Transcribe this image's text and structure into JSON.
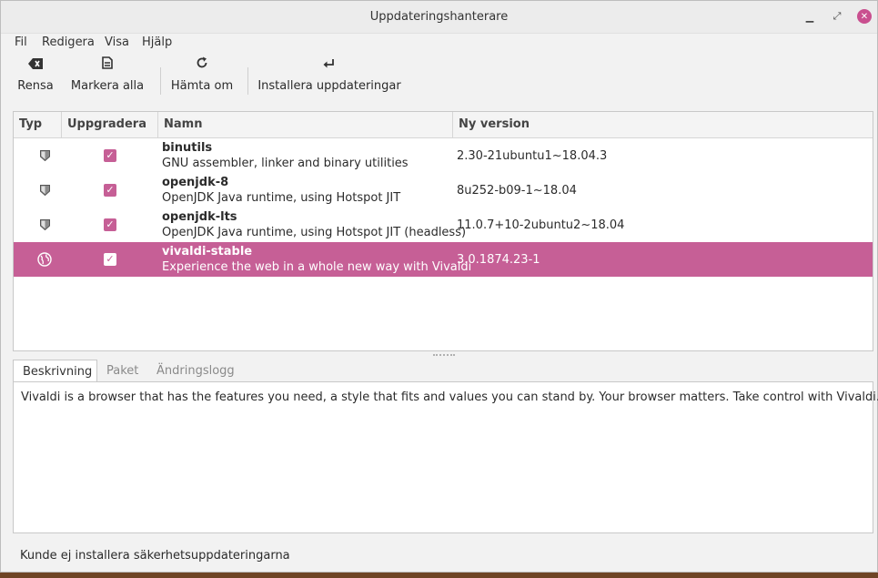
{
  "window": {
    "title": "Uppdateringshanterare"
  },
  "menu": {
    "file": "Fil",
    "edit": "Redigera",
    "view": "Visa",
    "help": "Hjälp"
  },
  "toolbar": {
    "clear": {
      "label": "Rensa",
      "icon": "backspace-icon"
    },
    "select_all": {
      "label": "Markera alla",
      "icon": "document-icon"
    },
    "refresh": {
      "label": "Hämta om",
      "icon": "refresh-icon"
    },
    "install": {
      "label": "Installera uppdateringar",
      "icon": "return-arrow-icon"
    }
  },
  "table": {
    "headers": {
      "type": "Typ",
      "upgrade": "Uppgradera",
      "name": "Namn",
      "new_version": "Ny version"
    },
    "rows": [
      {
        "icon": "shield-icon",
        "checked": true,
        "name": "binutils",
        "description": "GNU assembler, linker and binary utilities",
        "version": "2.30-21ubuntu1~18.04.3"
      },
      {
        "icon": "shield-icon",
        "checked": true,
        "name": "openjdk-8",
        "description": "OpenJDK Java runtime, using Hotspot JIT",
        "version": "8u252-b09-1~18.04"
      },
      {
        "icon": "shield-icon",
        "checked": true,
        "name": "openjdk-lts",
        "description": "OpenJDK Java runtime, using Hotspot JIT (headless)",
        "version": "11.0.7+10-2ubuntu2~18.04"
      },
      {
        "icon": "globe-icon",
        "checked": true,
        "name": "vivaldi-stable",
        "description": "Experience the web in a whole new way with Vivaldi",
        "version": "3.0.1874.23-1",
        "selected": true
      }
    ]
  },
  "tabs": {
    "description": "Beskrivning",
    "packages": "Paket",
    "changelog": "Ändringslogg"
  },
  "description_text": "Vivaldi is a browser that has the features you need, a style that fits and values you can stand by. Your browser matters. Take control with Vivaldi.",
  "status": "Kunde ej installera säkerhetsuppdateringarna",
  "colors": {
    "accent": "#c65f96"
  }
}
